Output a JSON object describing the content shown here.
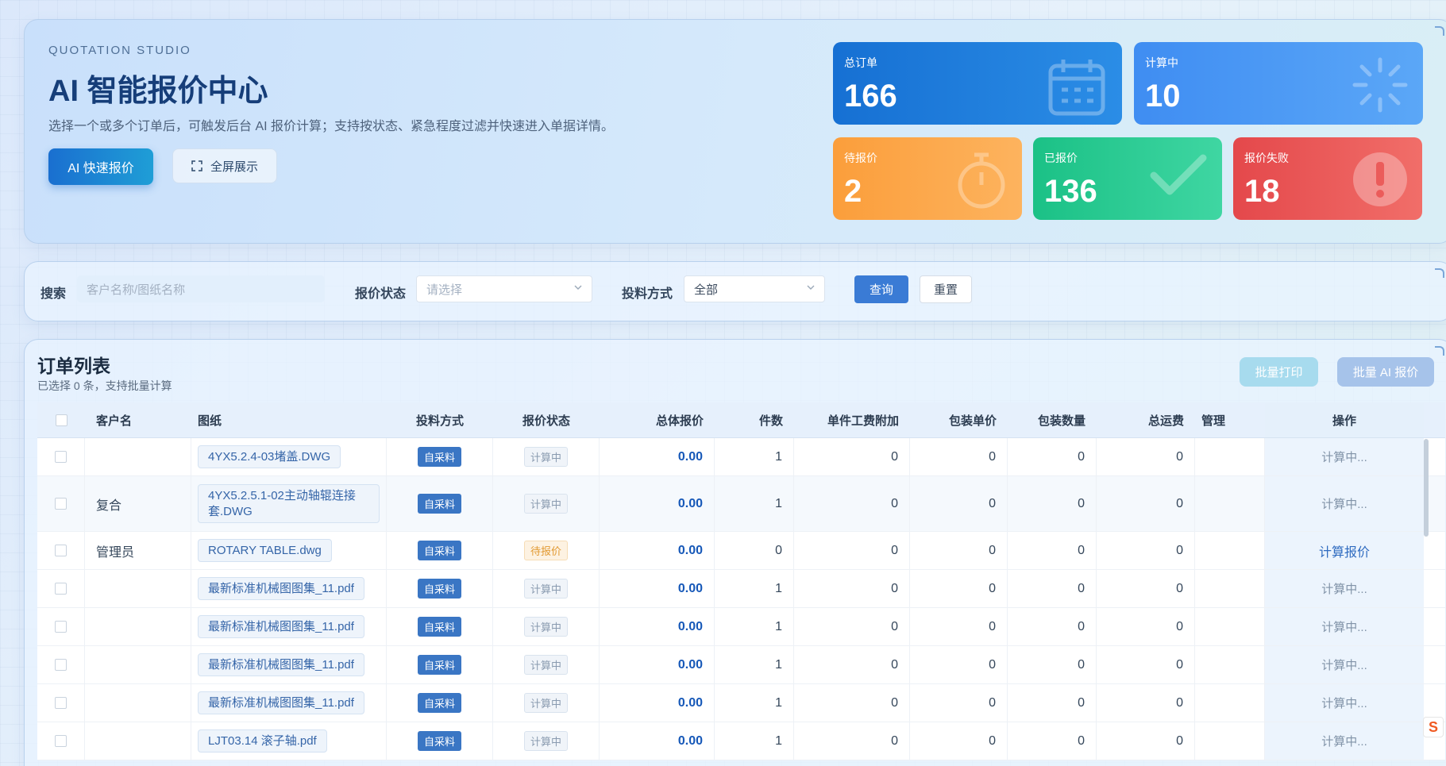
{
  "hero": {
    "eyebrow": "QUOTATION STUDIO",
    "title": "AI 智能报价中心",
    "subtitle": "选择一个或多个订单后，可触发后台 AI 报价计算；支持按状态、紧急程度过滤并快速进入单据详情。",
    "ai_button": "AI 快速报价",
    "fullscreen_button": "全屏展示"
  },
  "stats": {
    "total": {
      "label": "总订单",
      "value": "166",
      "icon": "calendar-icon"
    },
    "calculating": {
      "label": "计算中",
      "value": "10",
      "icon": "spinner-icon"
    },
    "pending": {
      "label": "待报价",
      "value": "2",
      "icon": "stopwatch-icon"
    },
    "quoted": {
      "label": "已报价",
      "value": "136",
      "icon": "check-icon"
    },
    "failed": {
      "label": "报价失败",
      "value": "18",
      "icon": "alert-icon"
    }
  },
  "filter": {
    "search_label": "搜索",
    "search_placeholder": "客户名称/图纸名称",
    "status_label": "报价状态",
    "status_placeholder": "请选择",
    "material_label": "投料方式",
    "material_value": "全部",
    "query_button": "查询",
    "reset_button": "重置"
  },
  "list": {
    "title": "订单列表",
    "subtitle": "已选择 0 条，支持批量计算",
    "print_button": "批量打印",
    "batch_button": "批量 AI 报价",
    "headers": {
      "customer": "客户名",
      "drawing": "图纸",
      "material": "投料方式",
      "status": "报价状态",
      "total": "总体报价",
      "qty": "件数",
      "fee": "单件工费附加",
      "pack_price": "包装单价",
      "pack_qty": "包装数量",
      "shipping": "总运费",
      "mgmt": "管理",
      "op": "操作"
    },
    "rows": [
      {
        "customer": "",
        "drawing": "4YX5.2.4-03堵盖.DWG",
        "material": "自采料",
        "status": "计算中",
        "total": "0.00",
        "qty": "1",
        "fee": "0",
        "pack_price": "0",
        "pack_qty": "0",
        "shipping": "0",
        "op": "计算中..."
      },
      {
        "customer": "复合",
        "drawing": "4YX5.2.5.1-02主动轴辊连接套.DWG",
        "material": "自采料",
        "status": "计算中",
        "total": "0.00",
        "qty": "1",
        "fee": "0",
        "pack_price": "0",
        "pack_qty": "0",
        "shipping": "0",
        "op": "计算中..."
      },
      {
        "customer": "管理员",
        "drawing": "ROTARY TABLE.dwg",
        "material": "自采料",
        "status": "待报价",
        "total": "0.00",
        "qty": "0",
        "fee": "0",
        "pack_price": "0",
        "pack_qty": "0",
        "shipping": "0",
        "op": "计算报价"
      },
      {
        "customer": "",
        "drawing": "最新标准机械图图集_11.pdf",
        "material": "自采料",
        "status": "计算中",
        "total": "0.00",
        "qty": "1",
        "fee": "0",
        "pack_price": "0",
        "pack_qty": "0",
        "shipping": "0",
        "op": "计算中..."
      },
      {
        "customer": "",
        "drawing": "最新标准机械图图集_11.pdf",
        "material": "自采料",
        "status": "计算中",
        "total": "0.00",
        "qty": "1",
        "fee": "0",
        "pack_price": "0",
        "pack_qty": "0",
        "shipping": "0",
        "op": "计算中..."
      },
      {
        "customer": "",
        "drawing": "最新标准机械图图集_11.pdf",
        "material": "自采料",
        "status": "计算中",
        "total": "0.00",
        "qty": "1",
        "fee": "0",
        "pack_price": "0",
        "pack_qty": "0",
        "shipping": "0",
        "op": "计算中..."
      },
      {
        "customer": "",
        "drawing": "最新标准机械图图集_11.pdf",
        "material": "自采料",
        "status": "计算中",
        "total": "0.00",
        "qty": "1",
        "fee": "0",
        "pack_price": "0",
        "pack_qty": "0",
        "shipping": "0",
        "op": "计算中..."
      },
      {
        "customer": "",
        "drawing": "LJT03.14 滚子轴.pdf",
        "material": "自采料",
        "status": "计算中",
        "total": "0.00",
        "qty": "1",
        "fee": "0",
        "pack_price": "0",
        "pack_qty": "0",
        "shipping": "0",
        "op": "计算中..."
      }
    ]
  },
  "colors": {
    "brand": "#1a6fd0",
    "total_value": "#1658b8",
    "pending": "#fb9e3b",
    "quoted": "#1bc186",
    "failed": "#e4484b"
  }
}
